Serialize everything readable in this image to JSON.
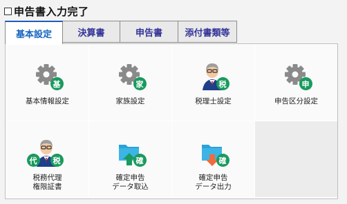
{
  "top": {
    "checkbox_label": "申告書入力完了",
    "checked": false
  },
  "tabs": [
    {
      "label": "基本設定",
      "active": true
    },
    {
      "label": "決算書",
      "active": false
    },
    {
      "label": "申告書",
      "active": false
    },
    {
      "label": "添付書類等",
      "active": false
    }
  ],
  "tiles": [
    {
      "label": "基本情報設定",
      "icon": "gear-icon",
      "badge": "基"
    },
    {
      "label": "家族設定",
      "icon": "gear-icon",
      "badge": "家"
    },
    {
      "label": "税理士設定",
      "icon": "person-icon",
      "badge": "税"
    },
    {
      "label": "申告区分設定",
      "icon": "gear-icon",
      "badge": "申"
    },
    {
      "label": "税務代理\n権限証書",
      "icon": "person-icon",
      "badge": "税",
      "badge2": "代"
    },
    {
      "label": "確定申告\nデータ取込",
      "icon": "folder-import-icon",
      "badge": "確"
    },
    {
      "label": "確定申告\nデータ出力",
      "icon": "folder-export-icon",
      "badge": "確"
    }
  ],
  "colors": {
    "accent": "#1565c0",
    "badge": "#1a9a5e",
    "tab_text": "#333399",
    "folder": "#29a3d8"
  }
}
